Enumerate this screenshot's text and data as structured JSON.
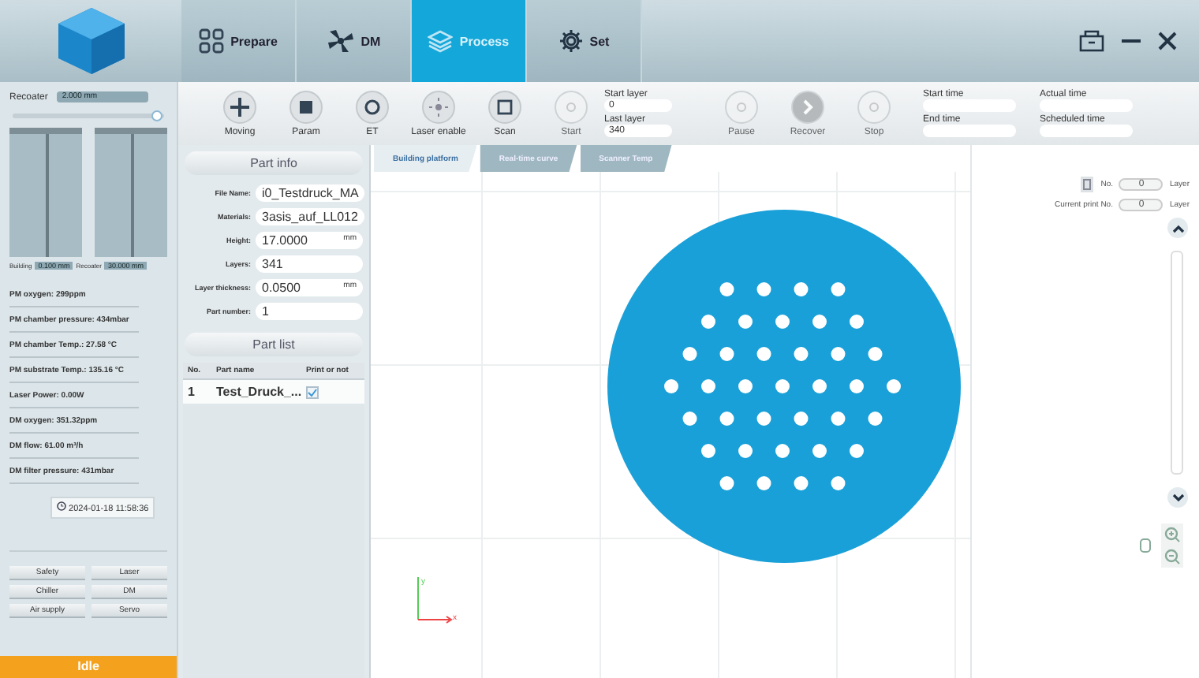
{
  "nav_tabs": [
    {
      "label": "Prepare",
      "selected": false
    },
    {
      "label": "DM",
      "selected": false
    },
    {
      "label": "Process",
      "selected": true
    },
    {
      "label": "Set",
      "selected": false
    }
  ],
  "toolbar": {
    "buttons": [
      {
        "label": "Moving",
        "disabled": false
      },
      {
        "label": "Param",
        "disabled": false
      },
      {
        "label": "ET",
        "disabled": false
      },
      {
        "label": "Laser enable",
        "disabled": false
      },
      {
        "label": "Scan",
        "disabled": false
      },
      {
        "label": "Start",
        "disabled": true
      },
      {
        "label": "Pause",
        "disabled": true
      },
      {
        "label": "Recover",
        "disabled": true
      },
      {
        "label": "Stop",
        "disabled": true
      }
    ],
    "start_layer": {
      "label": "Start layer",
      "value": "0"
    },
    "last_layer": {
      "label": "Last layer",
      "value": "340"
    },
    "times": [
      {
        "label": "Start time"
      },
      {
        "label": "End time"
      },
      {
        "label": "Actual time"
      },
      {
        "label": "Scheduled time"
      }
    ]
  },
  "left_panel": {
    "recoater": {
      "label": "Recoater",
      "value": "2.000 mm",
      "level": 0.95
    },
    "gauges": [
      {
        "label": "Building",
        "value": "0.100 mm"
      },
      {
        "label": "Recoater",
        "value": "30.000 mm"
      }
    ],
    "readings": [
      "PM oxygen: 299ppm",
      "PM chamber pressure: 434mbar",
      "PM chamber Temp.: 27.58 °C",
      "PM substrate Temp.: 135.16 °C",
      "Laser Power: 0.00W",
      "DM oxygen: 351.32ppm",
      "DM flow: 61.00 m³/h",
      "DM filter pressure: 431mbar"
    ],
    "datetime": "2024-01-18 11:58:36",
    "device_buttons": [
      "Safety",
      "Laser",
      "Chiller",
      "DM",
      "Air supply",
      "Servo"
    ],
    "status": "Idle"
  },
  "part_info": {
    "title": "Part info",
    "fields": [
      {
        "label": "File Name:",
        "value": "i0_Testdruck_MA"
      },
      {
        "label": "Materials:",
        "value": "3asis_auf_LL012"
      },
      {
        "label": "Height:",
        "value": "17.0000",
        "unit": "mm"
      },
      {
        "label": "Layers:",
        "value": "341"
      },
      {
        "label": "Layer thickness:",
        "value": "0.0500",
        "unit": "mm"
      },
      {
        "label": "Part number:",
        "value": "1"
      }
    ]
  },
  "part_list": {
    "title": "Part list",
    "columns": [
      "No.",
      "Part name",
      "Print or not"
    ],
    "rows": [
      {
        "no": "1",
        "name": "Test_Druck_...",
        "checked": true
      }
    ]
  },
  "view_tabs": [
    {
      "label": "Building platform",
      "selected": true
    },
    {
      "label": "Real-time curve",
      "selected": false
    },
    {
      "label": "Scanner Temp",
      "selected": false
    }
  ],
  "axes": {
    "x": "x",
    "y": "y"
  },
  "right_panel": {
    "layer_fields": [
      {
        "label": "No.",
        "value": "0",
        "unit": "Layer"
      },
      {
        "label": "Current print No.",
        "value": "0",
        "unit": "Layer"
      }
    ]
  }
}
